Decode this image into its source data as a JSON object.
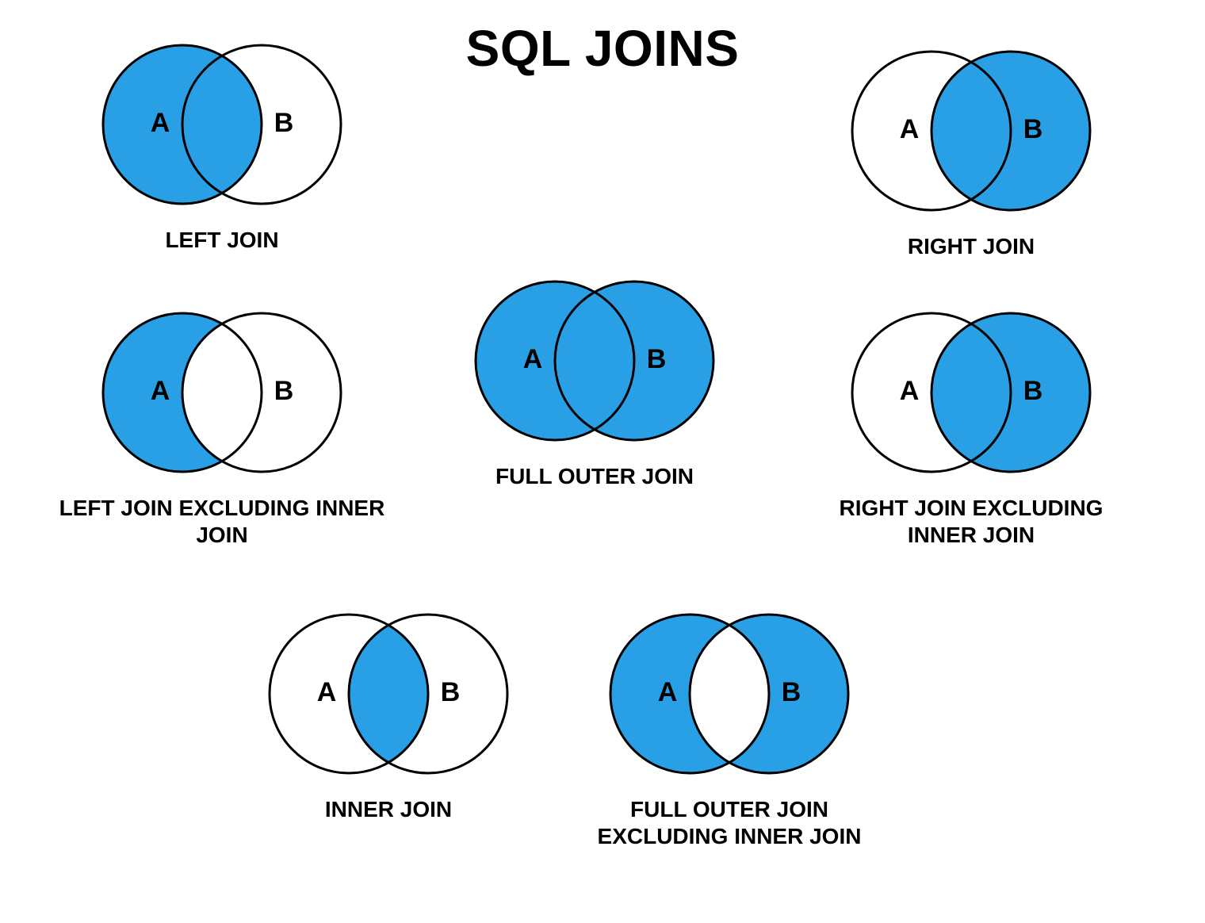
{
  "colors": {
    "fill": "#29A0E6",
    "stroke": "#000000",
    "background": "#FFFFFF"
  },
  "title": "SQL JOINS",
  "labels": {
    "a": "A",
    "b": "B"
  },
  "joins": {
    "left_join": {
      "caption": "LEFT JOIN",
      "fill_a": true,
      "fill_b": false,
      "fill_intersection": true
    },
    "right_join": {
      "caption": "RIGHT JOIN",
      "fill_a": false,
      "fill_b": true,
      "fill_intersection": true
    },
    "left_excl": {
      "caption": "LEFT JOIN EXCLUDING INNER JOIN",
      "fill_a": true,
      "fill_b": false,
      "fill_intersection": false
    },
    "full_outer": {
      "caption": "FULL OUTER JOIN",
      "fill_a": true,
      "fill_b": true,
      "fill_intersection": true
    },
    "right_excl": {
      "caption": "RIGHT JOIN EXCLUDING INNER JOIN",
      "fill_a": false,
      "fill_b": true,
      "fill_intersection": true
    },
    "inner": {
      "caption": "INNER JOIN",
      "fill_a": false,
      "fill_b": false,
      "fill_intersection": true
    },
    "full_outer_excl": {
      "caption": "FULL OUTER JOIN EXCLUDING INNER JOIN",
      "fill_a": true,
      "fill_b": true,
      "fill_intersection": false
    }
  }
}
